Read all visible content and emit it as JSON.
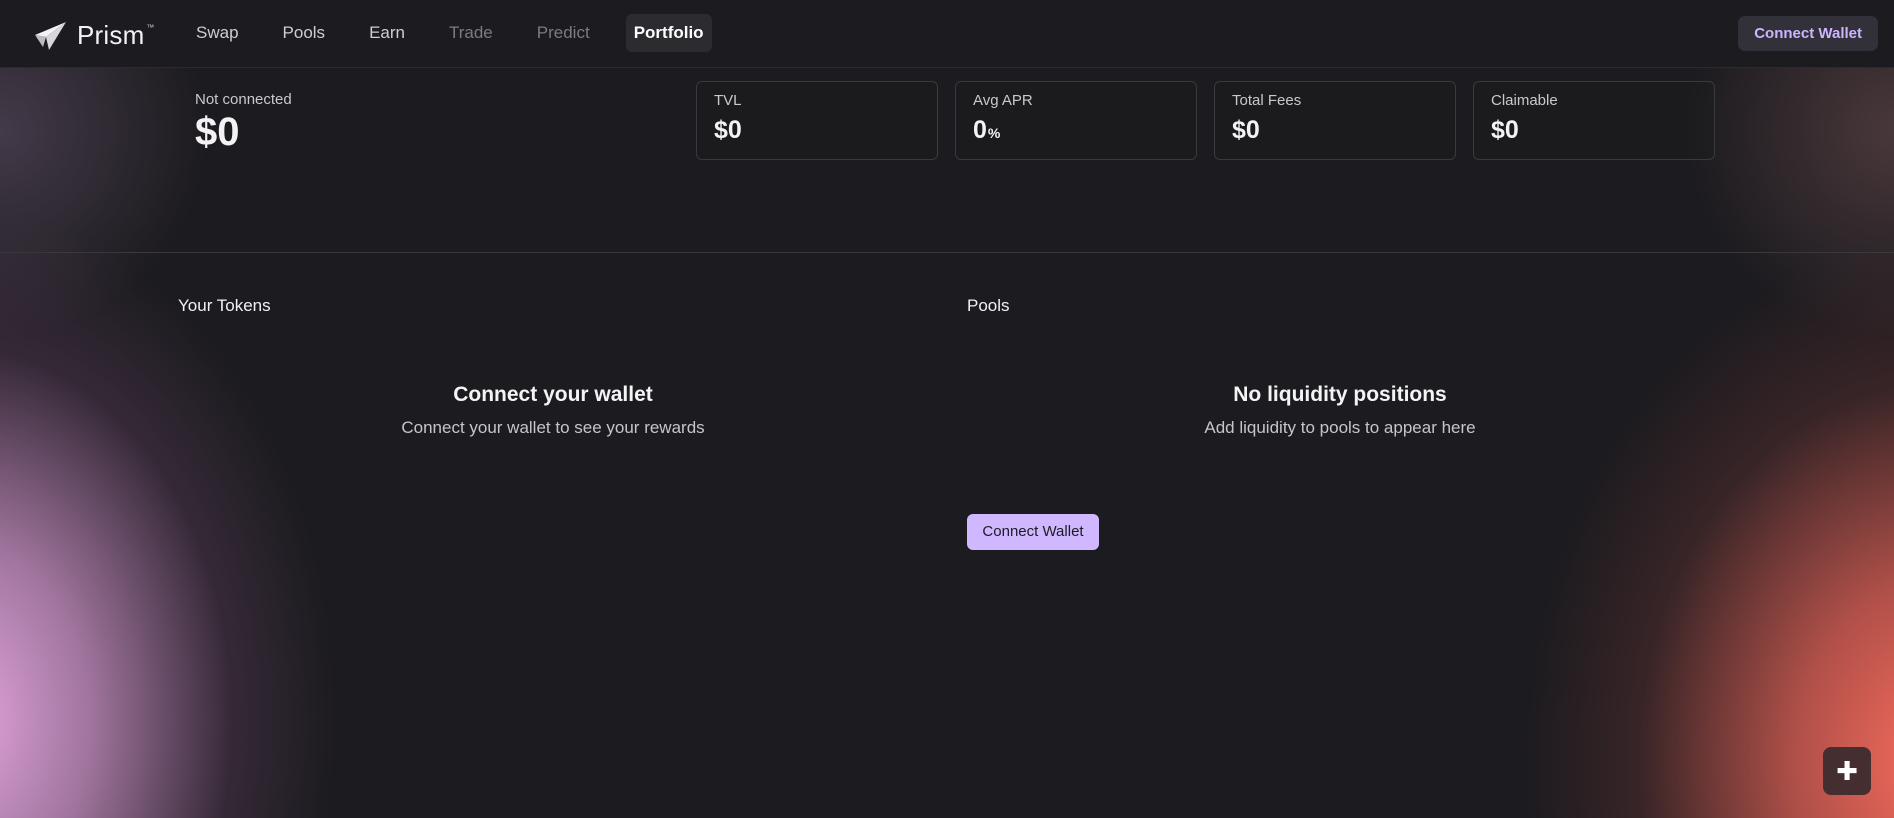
{
  "app": {
    "name": "Prism",
    "trademark": "™"
  },
  "nav": {
    "items": [
      {
        "label": "Swap",
        "state": "normal"
      },
      {
        "label": "Pools",
        "state": "normal"
      },
      {
        "label": "Earn",
        "state": "normal"
      },
      {
        "label": "Trade",
        "state": "disabled"
      },
      {
        "label": "Predict",
        "state": "disabled"
      },
      {
        "label": "Portfolio",
        "state": "active"
      }
    ]
  },
  "header": {
    "connect_label": "Connect Wallet"
  },
  "portfolio": {
    "status": "Not connected",
    "total_value": "$0",
    "stats": [
      {
        "label": "TVL",
        "value": "$0",
        "unit": ""
      },
      {
        "label": "Avg APR",
        "value": "0",
        "unit": "%"
      },
      {
        "label": "Total Fees",
        "value": "$0",
        "unit": ""
      },
      {
        "label": "Claimable",
        "value": "$0",
        "unit": ""
      }
    ]
  },
  "tokens_section": {
    "title": "Your Tokens",
    "empty_title": "Connect your wallet",
    "empty_desc": "Connect your wallet to see your rewards"
  },
  "pools_section": {
    "title": "Pools",
    "empty_title": "No liquidity positions",
    "empty_desc": "Add liquidity to pools to appear here",
    "connect_label": "Connect Wallet"
  },
  "fab": {
    "icon": "plus-icon",
    "symbol": "✚"
  },
  "colors": {
    "background": "#1c1b1f",
    "accent": "#cfb8ff",
    "accent_text": "#cdb4ff",
    "glow_left": "#e8aae1",
    "glow_right": "#ff6e5f"
  }
}
